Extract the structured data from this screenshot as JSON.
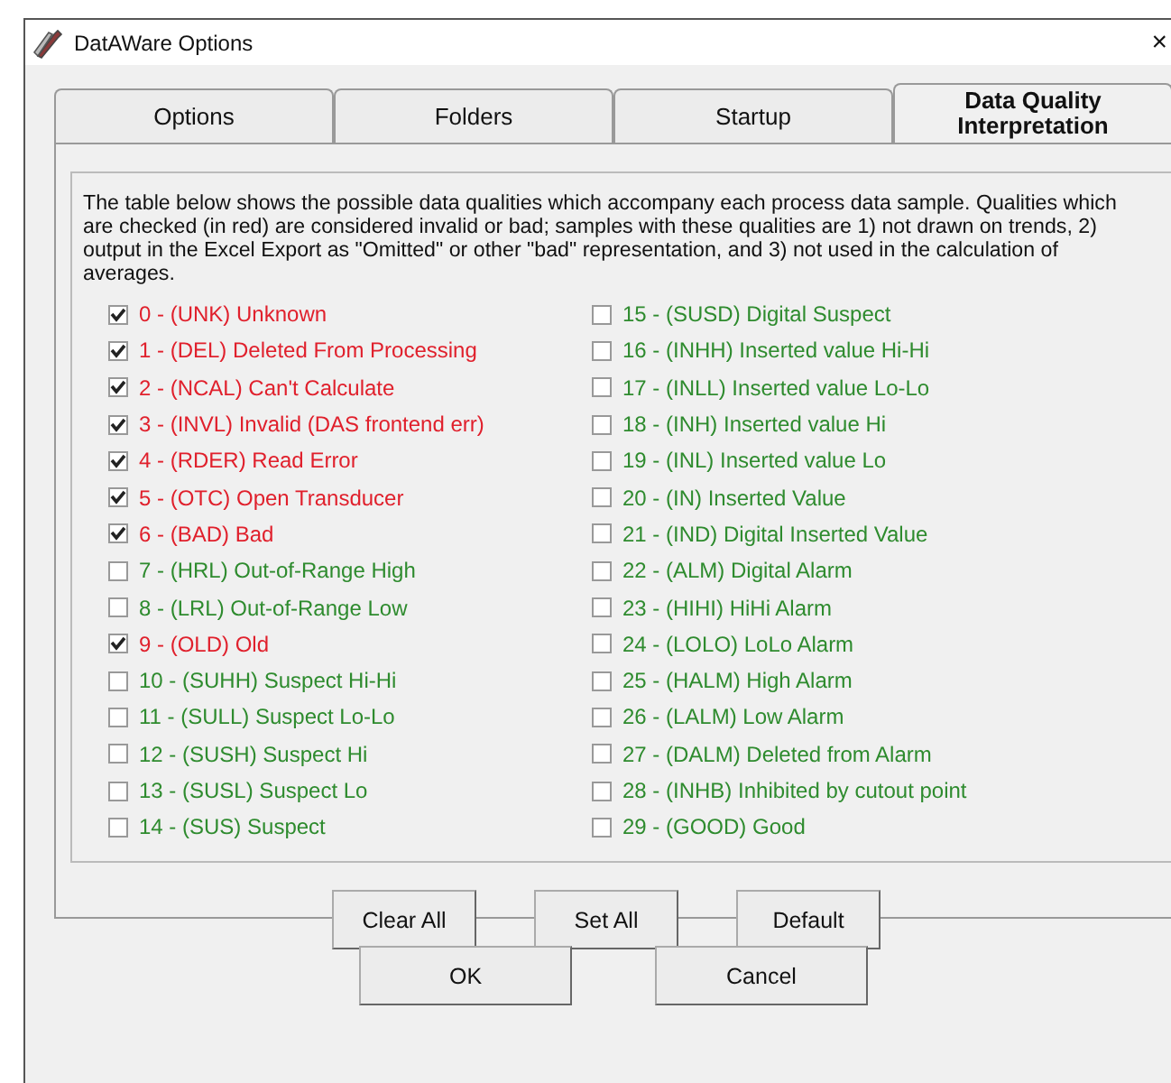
{
  "window": {
    "title": "DatAWare Options",
    "close": "×"
  },
  "tabs": [
    {
      "label": "Options",
      "selected": false
    },
    {
      "label": "Folders",
      "selected": false
    },
    {
      "label": "Startup",
      "selected": false
    },
    {
      "label": "Data Quality Interpretation",
      "selected": true
    }
  ],
  "description": "The table below shows the possible data qualities which accompany each process data sample.  Qualities which are checked (in red) are considered invalid or bad; samples with these qualities are 1) not drawn on trends, 2) output in the Excel Export as \"Omitted\" or other \"bad\" representation, and 3) not used in the calculation of averages.",
  "qualities": [
    {
      "label": "0 - (UNK) Unknown",
      "checked": true
    },
    {
      "label": "1 - (DEL) Deleted From Processing",
      "checked": true
    },
    {
      "label": "2 - (NCAL) Can't Calculate",
      "checked": true
    },
    {
      "label": "3 - (INVL) Invalid (DAS frontend err)",
      "checked": true
    },
    {
      "label": "4 - (RDER) Read Error",
      "checked": true
    },
    {
      "label": "5 - (OTC) Open Transducer",
      "checked": true
    },
    {
      "label": "6 - (BAD) Bad",
      "checked": true
    },
    {
      "label": "7 - (HRL) Out-of-Range High",
      "checked": false
    },
    {
      "label": "8 - (LRL) Out-of-Range Low",
      "checked": false
    },
    {
      "label": "9 - (OLD) Old",
      "checked": true
    },
    {
      "label": "10 - (SUHH) Suspect Hi-Hi",
      "checked": false
    },
    {
      "label": "11 - (SULL) Suspect Lo-Lo",
      "checked": false
    },
    {
      "label": "12 - (SUSH) Suspect Hi",
      "checked": false
    },
    {
      "label": "13 - (SUSL) Suspect Lo",
      "checked": false
    },
    {
      "label": "14 - (SUS) Suspect",
      "checked": false
    },
    {
      "label": "15 - (SUSD) Digital Suspect",
      "checked": false
    },
    {
      "label": "16 - (INHH) Inserted value Hi-Hi",
      "checked": false
    },
    {
      "label": "17 - (INLL) Inserted value Lo-Lo",
      "checked": false
    },
    {
      "label": "18 - (INH) Inserted value Hi",
      "checked": false
    },
    {
      "label": "19 - (INL) Inserted value Lo",
      "checked": false
    },
    {
      "label": "20 - (IN) Inserted Value",
      "checked": false
    },
    {
      "label": "21 - (IND) Digital Inserted Value",
      "checked": false
    },
    {
      "label": "22 - (ALM) Digital Alarm",
      "checked": false
    },
    {
      "label": "23 - (HIHI) HiHi Alarm",
      "checked": false
    },
    {
      "label": "24 - (LOLO) LoLo Alarm",
      "checked": false
    },
    {
      "label": "25 - (HALM) High Alarm",
      "checked": false
    },
    {
      "label": "26 - (LALM) Low Alarm",
      "checked": false
    },
    {
      "label": "27 - (DALM) Deleted from Alarm",
      "checked": false
    },
    {
      "label": "28 - (INHB) Inhibited by cutout point",
      "checked": false
    },
    {
      "label": "29 - (GOOD) Good",
      "checked": false
    }
  ],
  "panel_buttons": [
    "Clear All",
    "Set All",
    "Default"
  ],
  "dialog_buttons": [
    "OK",
    "Cancel"
  ]
}
